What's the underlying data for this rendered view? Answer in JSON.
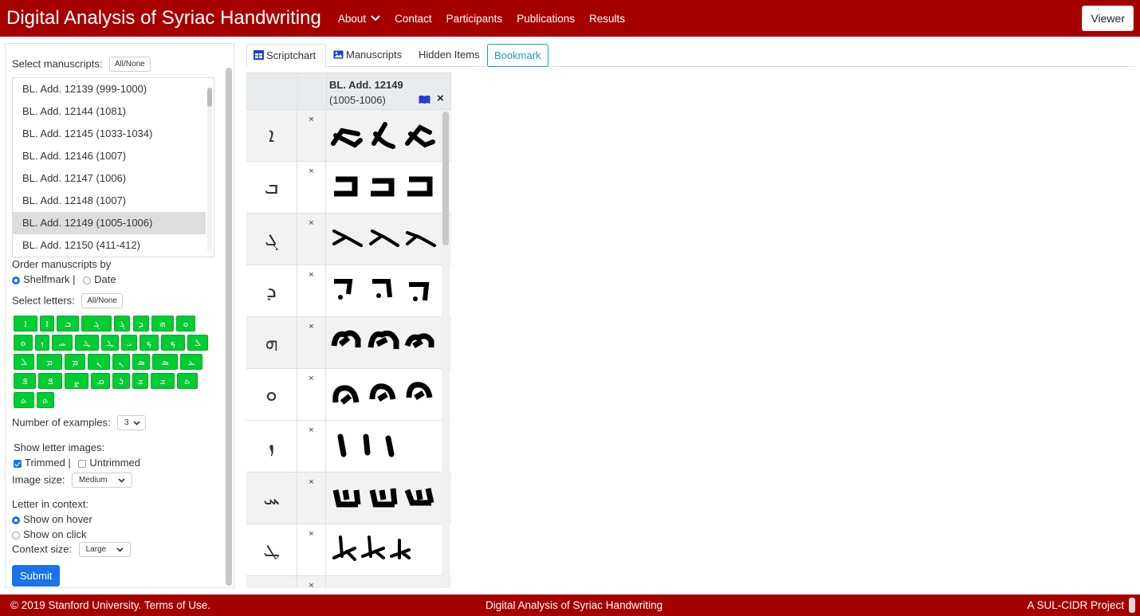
{
  "nav": {
    "brand": "Digital Analysis of Syriac Handwriting",
    "items": [
      "About",
      "Contact",
      "Participants",
      "Publications",
      "Results"
    ],
    "viewer_button": "Viewer"
  },
  "sidebar": {
    "select_manuscripts_label": "Select manuscripts:",
    "all_none_label": "All/None",
    "manuscripts": [
      {
        "label": "BL. Add. 12139 (999-1000)",
        "selected": false
      },
      {
        "label": "BL. Add. 12144 (1081)",
        "selected": false
      },
      {
        "label": "BL. Add. 12145 (1033-1034)",
        "selected": false
      },
      {
        "label": "BL. Add. 12146 (1007)",
        "selected": false
      },
      {
        "label": "BL. Add. 12147 (1006)",
        "selected": false
      },
      {
        "label": "BL. Add. 12148 (1007)",
        "selected": false
      },
      {
        "label": "BL. Add. 12149 (1005-1006)",
        "selected": true
      },
      {
        "label": "BL. Add. 12150 (411-412)",
        "selected": false
      }
    ],
    "order_label": "Order manuscripts by",
    "order_options": [
      "Shelfmark |",
      "Date"
    ],
    "order_selected": "Shelfmark",
    "select_letters_label": "Select letters:",
    "letters_all_none": "All/None",
    "letter_buttons": [
      "ܐ",
      "ܐ",
      "ܒ",
      "ܓ",
      "ܓ",
      "ܕ",
      "ܗ",
      "ܘ",
      "ܘ",
      "ܙ",
      "ܚ",
      "ܛ",
      "ܛ",
      "ܝ",
      "ܟ",
      "ܟ",
      "ܠ",
      "ܠ",
      "ܡ",
      "ܡ",
      "ܢ",
      "ܢ",
      "ܣ",
      "ܣ",
      "ܥ",
      "ܦ",
      "ܦ",
      "ܨ",
      "ܩ",
      "ܪ",
      "ܫ",
      "ܫ",
      "ܬ",
      "ܬ",
      "ܬ"
    ],
    "num_examples_label": "Number of examples:",
    "num_examples_value": "3",
    "show_images_label": "Show letter images:",
    "trimmed_label": "Trimmed |",
    "untrimmed_label": "Untrimmed",
    "trimmed_checked": true,
    "untrimmed_checked": false,
    "image_size_label": "Image size:",
    "image_size_value": "Medium",
    "context_label": "Letter in context:",
    "context_options": [
      "Show on hover",
      "Show on click"
    ],
    "context_selected": "Show on hover",
    "context_size_label": "Context size:",
    "context_size_value": "Large",
    "submit_label": "Submit"
  },
  "tabs": {
    "scriptchart": "Scriptchart",
    "manuscripts": "Manuscripts",
    "hidden_items": "Hidden Items",
    "bookmark": "Bookmark"
  },
  "scriptchart": {
    "manuscript_title": "BL. Add. 12149",
    "manuscript_date": "(1005-1006)",
    "remove_symbol": "×",
    "rows": [
      {
        "letter": "ܐ"
      },
      {
        "letter": "ܒ"
      },
      {
        "letter": "ܓ"
      },
      {
        "letter": "ܕ"
      },
      {
        "letter": "ܗ"
      },
      {
        "letter": "ܘ"
      },
      {
        "letter": "ܙ"
      },
      {
        "letter": "ܚ"
      },
      {
        "letter": "ܛ"
      },
      {
        "letter": ""
      }
    ]
  },
  "footer": {
    "left": "© 2019 Stanford University. Terms of Use.",
    "center": "Digital Analysis of Syriac Handwriting",
    "right": "A SUL-CIDR Project"
  }
}
